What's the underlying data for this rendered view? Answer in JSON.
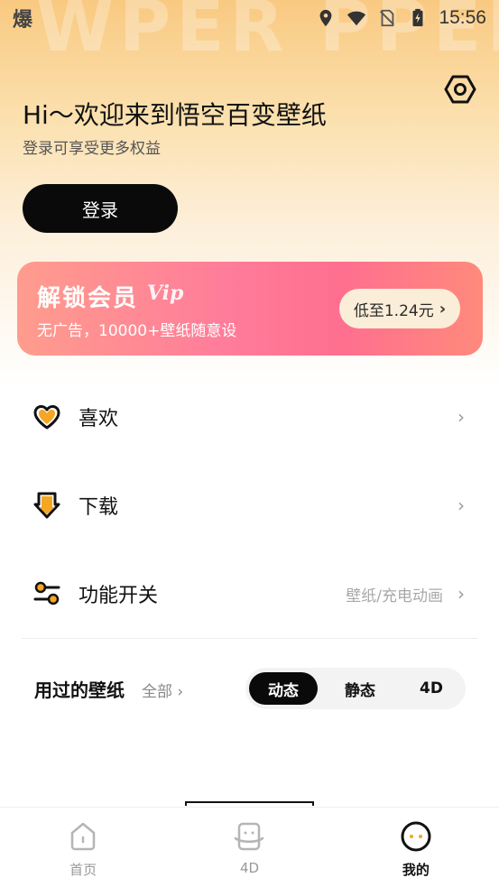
{
  "status_bar": {
    "app_glyph": "爆",
    "time": "15:56"
  },
  "header": {
    "watermark": "WPER PPEBTIE",
    "greeting": "Hi～欢迎来到悟空百变壁纸",
    "subtitle": "登录可享受更多权益",
    "login_label": "登录"
  },
  "vip_banner": {
    "title": "解锁会员",
    "mark": "Vip",
    "subtitle": "无广告，10000+壁纸随意设",
    "price_label": "低至1.24元"
  },
  "menu": [
    {
      "label": "喜欢",
      "extra": "",
      "icon": "heart-icon"
    },
    {
      "label": "下载",
      "extra": "",
      "icon": "download-icon"
    },
    {
      "label": "功能开关",
      "extra": "壁纸/充电动画",
      "icon": "toggle-sliders-icon"
    }
  ],
  "used": {
    "title": "用过的壁纸",
    "all_label": "全部",
    "tabs": [
      "动态",
      "静态",
      "4D"
    ],
    "active_tab": "动态"
  },
  "bottom_nav": [
    {
      "label": "首页",
      "icon": "home-icon",
      "active": false
    },
    {
      "label": "4D",
      "icon": "4d-icon",
      "active": false
    },
    {
      "label": "我的",
      "icon": "profile-face-icon",
      "active": true
    }
  ],
  "colors": {
    "accent": "#f5a623",
    "primary_button": "#0a0a0a",
    "vip_gradient_start": "#ff9c8d",
    "vip_gradient_end": "#ff6f8f",
    "price_pill": "#fbeed8"
  }
}
